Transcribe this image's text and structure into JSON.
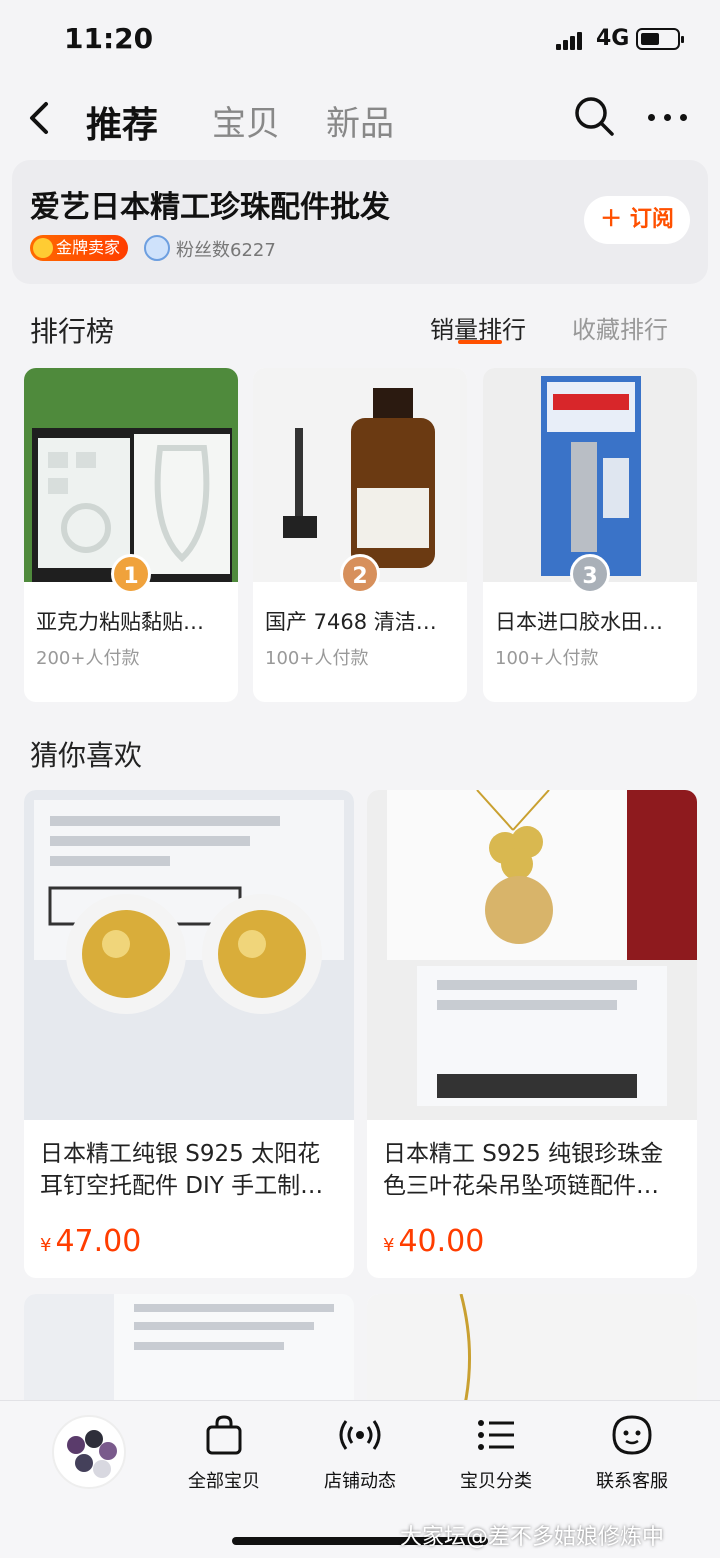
{
  "status_bar": {
    "time": "11:20",
    "network": "4G"
  },
  "nav": {
    "tabs": [
      {
        "label": "推荐",
        "active": true
      },
      {
        "label": "宝贝",
        "active": false
      },
      {
        "label": "新品",
        "active": false
      }
    ],
    "back_icon": "chevron-left-icon",
    "search_icon": "search-icon",
    "more_icon": "more-dots-icon"
  },
  "shop": {
    "name": "爱艺日本精工珍珠配件批发",
    "badge": "金牌卖家",
    "fans": "粉丝数6227",
    "subscribe_label": "订阅"
  },
  "ranking": {
    "title": "排行榜",
    "tabs": [
      {
        "label": "销量排行",
        "active": true
      },
      {
        "label": "收藏排行",
        "active": false
      }
    ],
    "items": [
      {
        "rank": "1",
        "name": "亚克力粘贴黏贴…",
        "sales": "200+人付款"
      },
      {
        "rank": "2",
        "name": "国产 7468 清洁…",
        "sales": "100+人付款"
      },
      {
        "rank": "3",
        "name": "日本进口胶水田…",
        "sales": "100+人付款"
      }
    ]
  },
  "recommend": {
    "title": "猜你喜欢",
    "items": [
      {
        "title": "日本精工纯银 S925 太阳花耳钉空托配件 DIY 手工制…",
        "currency": "¥",
        "price": "47.00"
      },
      {
        "title": "日本精工 S925 纯银珍珠金色三叶花朵吊坠项链配件…",
        "currency": "¥",
        "price": "40.00"
      }
    ]
  },
  "bottom_bar": {
    "items": [
      {
        "label": "全部宝贝",
        "icon": "shopping-bag-icon"
      },
      {
        "label": "店铺动态",
        "icon": "broadcast-icon"
      },
      {
        "label": "宝贝分类",
        "icon": "list-icon"
      },
      {
        "label": "联系客服",
        "icon": "chat-bubble-icon"
      }
    ]
  },
  "watermark": "大家坛@差不多姑娘修炼中",
  "colors": {
    "accent": "#ff5000",
    "price": "#ff3d00"
  }
}
